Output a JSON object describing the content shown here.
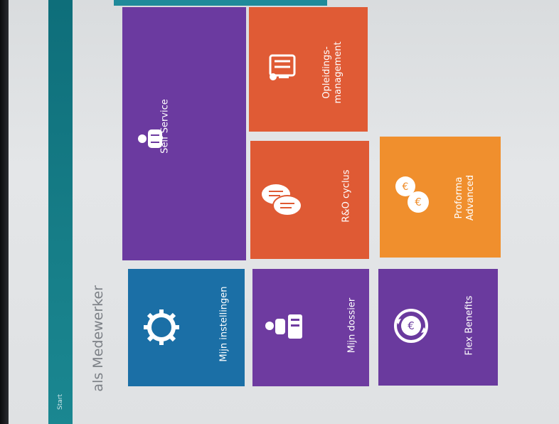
{
  "header": {
    "teal_label": "Start",
    "page_title": "als Medewerker"
  },
  "tiles": {
    "self_service": {
      "label": "Self Service",
      "icon": "person-icon",
      "color": "#6b3aa0"
    },
    "opleidings": {
      "label": "Opleidings-\nmanagement",
      "icon": "certificate-icon",
      "color": "#e05b35"
    },
    "ro_cyclus": {
      "label": "R&O cyclus",
      "icon": "chat-bubbles-icon",
      "color": "#df5a34"
    },
    "proforma": {
      "label": "Proforma\nAdvanced",
      "icon": "coins-icon",
      "color": "#f08f2d"
    },
    "mijn_instellingen": {
      "label": "Mijn instellingen",
      "icon": "gear-icon",
      "color": "#1b6fa6"
    },
    "mijn_dossier": {
      "label": "Mijn dossier",
      "icon": "person-folder-icon",
      "color": "#6e3ba0"
    },
    "flex_benefits": {
      "label": "Flex Benefits",
      "icon": "euro-cycle-icon",
      "color": "#6a3a9e"
    }
  }
}
